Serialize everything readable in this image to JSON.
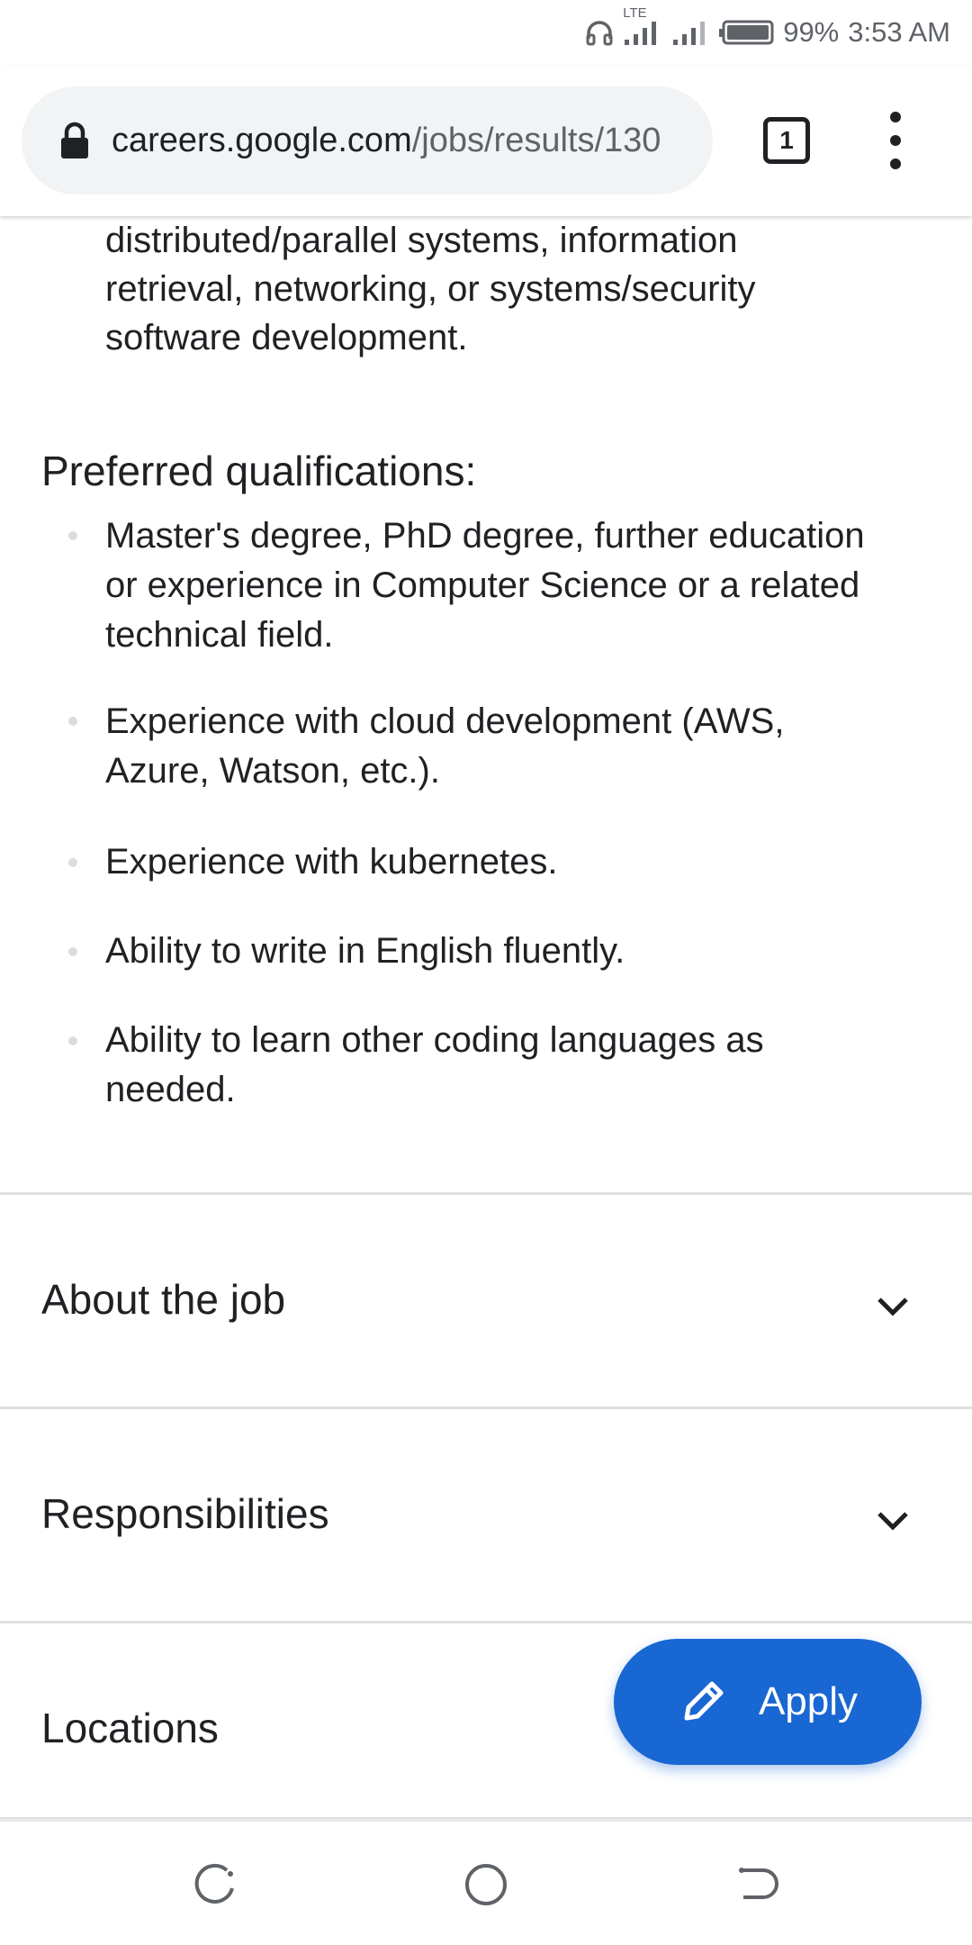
{
  "status_bar": {
    "network_type": "LTE",
    "battery": "99%",
    "time": "3:53 AM"
  },
  "browser": {
    "url_host": "careers.google.com",
    "url_path": "/jobs/results/130",
    "tab_count": "1"
  },
  "content": {
    "continued_lines": [
      "distributed/parallel systems, information",
      "retrieval, networking, or systems/security",
      "software development."
    ],
    "preferred_heading": "Preferred qualifications:",
    "preferred_items": [
      {
        "lines": [
          "Master's degree, PhD degree, further education",
          "or experience in Computer Science or a related",
          "technical field."
        ]
      },
      {
        "lines": [
          "Experience with cloud development (AWS,",
          "Azure, Watson, etc.)."
        ]
      },
      {
        "lines": [
          "Experience with kubernetes."
        ]
      },
      {
        "lines": [
          "Ability to write in English fluently."
        ]
      },
      {
        "lines": [
          "Ability to learn other coding languages as",
          "needed."
        ]
      }
    ],
    "accordions": [
      {
        "title": "About the job",
        "icon": "chevron-down-icon"
      },
      {
        "title": "Responsibilities",
        "icon": "chevron-down-icon"
      },
      {
        "title": "Locations"
      }
    ]
  },
  "fab": {
    "label": "Apply",
    "icon": "pencil-icon",
    "color": "#1967d2"
  },
  "nav_bar": {
    "icons": [
      "recent-apps-icon",
      "home-icon",
      "back-icon"
    ]
  }
}
